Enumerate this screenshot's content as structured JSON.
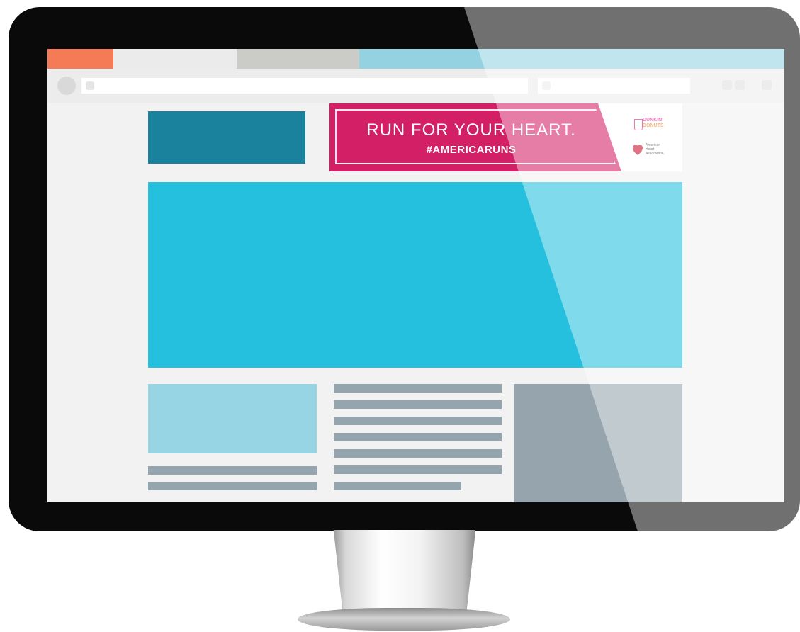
{
  "colors": {
    "monitor_bezel": "#0a0a0a",
    "tab_active": "#f47b55",
    "tab_light": "#ebebeb",
    "tab_grey": "#cbcbc7",
    "tab_blue": "#94d2e2",
    "logo_block": "#1b829e",
    "ad_pink": "#d31f66",
    "hero": "#24c0de",
    "card_image": "#98d5e4",
    "text_bar": "#94a5ae",
    "side_block": "#95a4ad"
  },
  "browser": {
    "tabs": [
      "",
      "",
      "",
      ""
    ],
    "nav_icon": "circle-button-icon",
    "window_controls": [
      "control-icon",
      "control-icon",
      "control-icon"
    ]
  },
  "ad_banner": {
    "headline": "RUN FOR YOUR HEART.",
    "hashtag": "#AMERICARUNS",
    "sponsors": {
      "dunkin_line1": "DUNKIN'",
      "dunkin_line2": "DONUTS",
      "aha_line1": "American",
      "aha_line2": "Heart",
      "aha_line3": "Association."
    }
  },
  "icons": {
    "nav": "circle-button-icon",
    "url": "page-icon",
    "search": "search-icon",
    "dunkin_logo": "cup-icon",
    "aha_logo": "heart-icon"
  }
}
